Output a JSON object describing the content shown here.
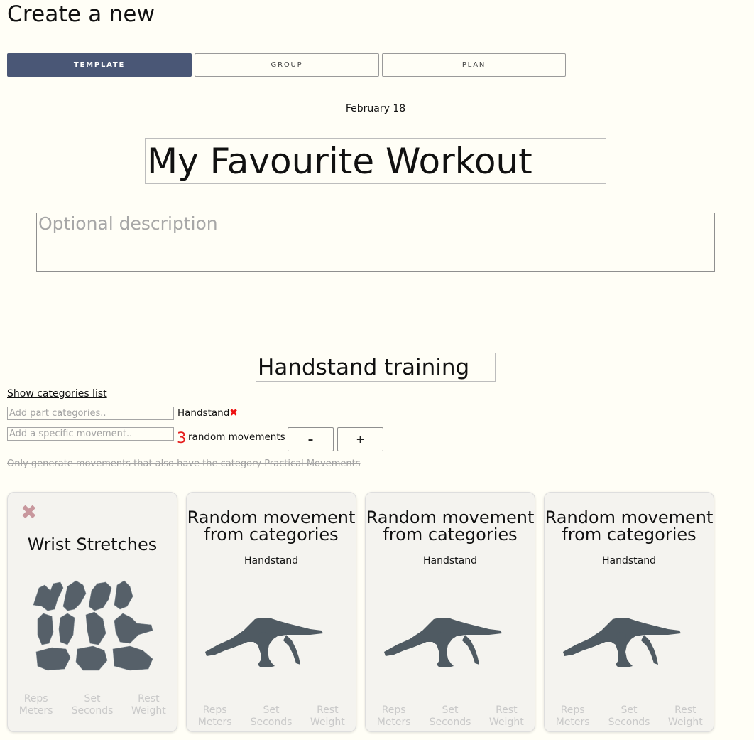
{
  "page": {
    "title": "Create a new"
  },
  "tabs": [
    {
      "label": "TEMPLATE",
      "active": true
    },
    {
      "label": "GROUP",
      "active": false
    },
    {
      "label": "PLAN",
      "active": false
    }
  ],
  "date": "February 18",
  "workout": {
    "name": "My Favourite Workout",
    "description_placeholder": "Optional description"
  },
  "part": {
    "name": "Handstand training",
    "show_categories_link": "Show categories list",
    "category_input_placeholder": "Add part categories..",
    "movement_input_placeholder": "Add a specific movement..",
    "category_tag": "Handstand",
    "category_remove_icon": "✖",
    "random_count": "3",
    "random_label": "random movements",
    "decrement_label": "–",
    "increment_label": "+",
    "filter_note": "Only generate movements that also have the category Practical Movements"
  },
  "cards": [
    {
      "close_icon": "✖",
      "title": "Wrist Stretches",
      "category": "",
      "labels": [
        [
          "Reps",
          "Meters"
        ],
        [
          "Set",
          "Seconds"
        ],
        [
          "Rest",
          "Weight"
        ]
      ],
      "image": "wrist-stretches-illustration"
    },
    {
      "title_line1": "Random movement",
      "title_line2": "from categories",
      "category": "Handstand",
      "labels": [
        [
          "Reps",
          "Meters"
        ],
        [
          "Set",
          "Seconds"
        ],
        [
          "Rest",
          "Weight"
        ]
      ],
      "image": "handstand-silhouette"
    },
    {
      "title_line1": "Random movement",
      "title_line2": "from categories",
      "category": "Handstand",
      "labels": [
        [
          "Reps",
          "Meters"
        ],
        [
          "Set",
          "Seconds"
        ],
        [
          "Rest",
          "Weight"
        ]
      ],
      "image": "handstand-silhouette"
    },
    {
      "title_line1": "Random movement",
      "title_line2": "from categories",
      "category": "Handstand",
      "labels": [
        [
          "Reps",
          "Meters"
        ],
        [
          "Set",
          "Seconds"
        ],
        [
          "Rest",
          "Weight"
        ]
      ],
      "image": "handstand-silhouette"
    }
  ],
  "colors": {
    "background": "#fffef6",
    "tab_active": "#4a5776",
    "accent_red": "#e51c1c",
    "card_bg": "#f4f3ef",
    "silhouette": "#4f5a62",
    "muted_text": "#c9c9c9"
  }
}
